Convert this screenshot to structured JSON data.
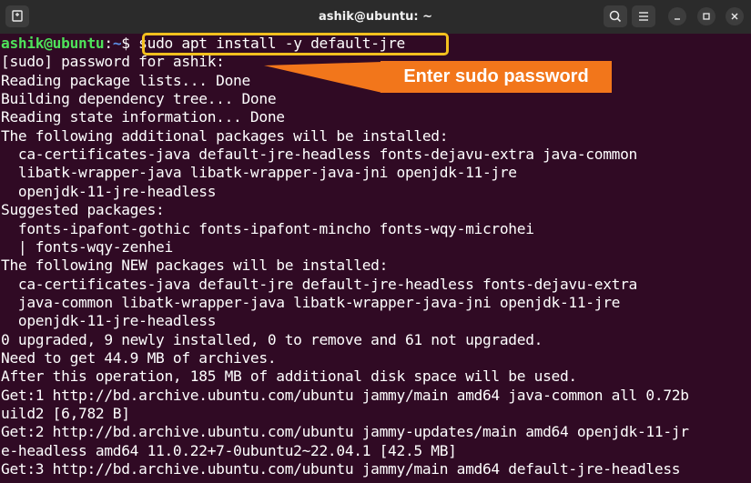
{
  "window": {
    "title": "ashik@ubuntu: ~"
  },
  "prompt": {
    "user_host": "ashik@ubuntu",
    "separator": ":",
    "path": "~",
    "symbol": "$ ",
    "command": "sudo apt install -y default-jre"
  },
  "callout": {
    "text": "Enter sudo password"
  },
  "colors": {
    "terminal_bg": "#300a24",
    "prompt_user": "#4ee25a",
    "prompt_path": "#5b8fe4",
    "highlight_box": "#f2c01e",
    "callout_bg": "#f2761b"
  },
  "icons": {
    "new_tab": "new-tab-icon",
    "search": "search-icon",
    "menu": "hamburger-menu-icon",
    "minimize": "minimize-icon",
    "maximize": "maximize-icon",
    "close": "close-icon"
  },
  "output": [
    "[sudo] password for ashik:",
    "Reading package lists... Done",
    "Building dependency tree... Done",
    "Reading state information... Done",
    "The following additional packages will be installed:",
    "  ca-certificates-java default-jre-headless fonts-dejavu-extra java-common",
    "  libatk-wrapper-java libatk-wrapper-java-jni openjdk-11-jre",
    "  openjdk-11-jre-headless",
    "Suggested packages:",
    "  fonts-ipafont-gothic fonts-ipafont-mincho fonts-wqy-microhei",
    "  | fonts-wqy-zenhei",
    "The following NEW packages will be installed:",
    "  ca-certificates-java default-jre default-jre-headless fonts-dejavu-extra",
    "  java-common libatk-wrapper-java libatk-wrapper-java-jni openjdk-11-jre",
    "  openjdk-11-jre-headless",
    "0 upgraded, 9 newly installed, 0 to remove and 61 not upgraded.",
    "Need to get 44.9 MB of archives.",
    "After this operation, 185 MB of additional disk space will be used.",
    "Get:1 http://bd.archive.ubuntu.com/ubuntu jammy/main amd64 java-common all 0.72b",
    "uild2 [6,782 B]",
    "Get:2 http://bd.archive.ubuntu.com/ubuntu jammy-updates/main amd64 openjdk-11-jr",
    "e-headless amd64 11.0.22+7-0ubuntu2~22.04.1 [42.5 MB]",
    "Get:3 http://bd.archive.ubuntu.com/ubuntu jammy/main amd64 default-jre-headless"
  ]
}
